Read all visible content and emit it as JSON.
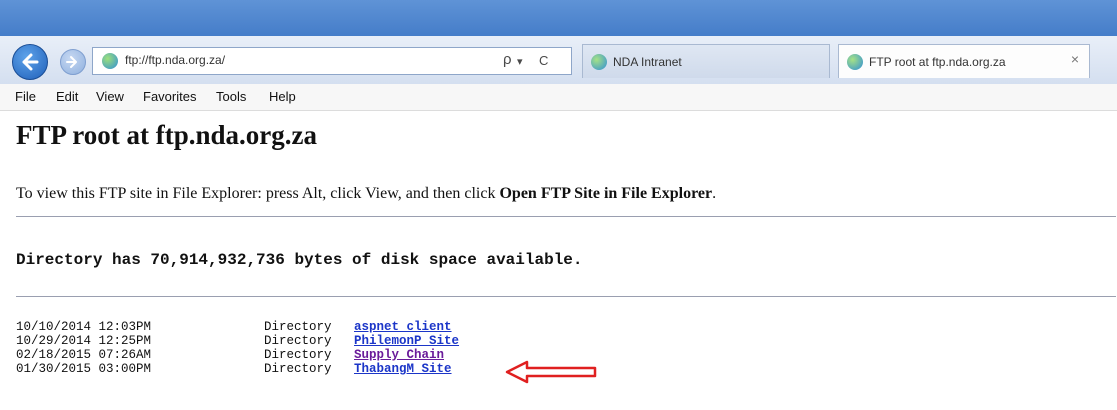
{
  "browser": {
    "address_url": "ftp://ftp.nda.org.za/",
    "tabs": [
      {
        "label": "NDA Intranet"
      },
      {
        "label": "FTP root at ftp.nda.org.za",
        "close": "×"
      }
    ],
    "menu": [
      "File",
      "Edit",
      "View",
      "Favorites",
      "Tools",
      "Help"
    ],
    "icons": {
      "back": "back-arrow-icon",
      "forward": "forward-arrow-icon",
      "search": "ρ",
      "dropdown": "▾",
      "refresh": "C"
    }
  },
  "page": {
    "title": "FTP root at ftp.nda.org.za",
    "hint_prefix": "To view this FTP site in File Explorer: press Alt, click View, and then click ",
    "hint_bold": "Open FTP Site in File Explorer",
    "hint_suffix": ".",
    "disk_space": "Directory has 70,914,932,736 bytes of disk space available.",
    "listing": [
      {
        "date": "10/10/2014 12:03PM",
        "type": "Directory",
        "name": "aspnet client"
      },
      {
        "date": "10/29/2014 12:25PM",
        "type": "Directory",
        "name": "PhilemonP Site"
      },
      {
        "date": "02/18/2015 07:26AM",
        "type": "Directory",
        "name": "Supply Chain"
      },
      {
        "date": "01/30/2015 03:00PM",
        "type": "Directory",
        "name": "ThabangM Site"
      }
    ]
  },
  "colors": {
    "link": "#1b35c8",
    "visited_link": "#6a1b9a",
    "annotation_arrow": "#e02020"
  }
}
